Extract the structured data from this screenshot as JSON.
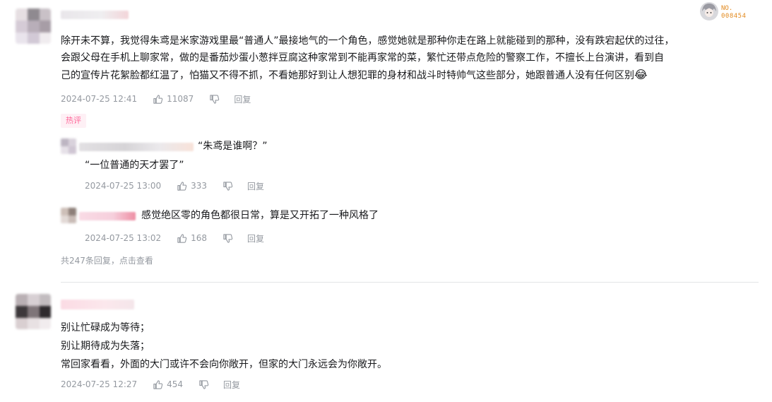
{
  "comments": [
    {
      "content_lines": [
        "除开未不算，我觉得朱鸢是米家游戏里最“普通人”最接地气的一个角色，感觉她就是那种你走在路上就能碰到的那种，没有跌宕起伏的过往，",
        "会跟父母在手机上聊家常，做的是番茄炒蛋小葱拌豆腐这种家常到不能再家常的菜，繁忙还带点危险的警察工作，不擅长上台演讲，看到自",
        "己的宣传片花絮脸都红温了，怕猫又不得不抓，不看她那好到让人想犯罪的身材和战斗时特帅气这些部分，她跟普通人没有任何区别"
      ],
      "emoji": "😂",
      "time": "2024-07-25 12:41",
      "likes": "11087",
      "reply_label": "回复",
      "hot_tag": "热评",
      "badge": {
        "no": "NO.",
        "number": "008454"
      },
      "replies": [
        {
          "line1": "“朱鸢是谁啊？”",
          "line2": "“一位普通的天才罢了”",
          "time": "2024-07-25 13:00",
          "likes": "333",
          "reply_label": "回复"
        },
        {
          "line1": "感觉绝区零的角色都很日常，算是又开拓了一种风格了",
          "time": "2024-07-25 13:02",
          "likes": "168",
          "reply_label": "回复"
        }
      ],
      "more_replies": "共247条回复，点击查看"
    },
    {
      "content_lines": [
        "别让忙碌成为等待；",
        "别让期待成为失落；",
        "常回家看看，外面的大门或许不会向你敞开，但家的大门永远会为你敞开。"
      ],
      "time": "2024-07-25 12:27",
      "likes": "454",
      "reply_label": "回复"
    }
  ],
  "colors": {
    "text": "#18191c",
    "meta": "#9499a0",
    "hot_tag_bg": "#fef0f5",
    "hot_tag_text": "#ff6699",
    "badge": "#e28a1f"
  },
  "icons": [
    "thumb-up-icon",
    "thumb-down-icon"
  ]
}
